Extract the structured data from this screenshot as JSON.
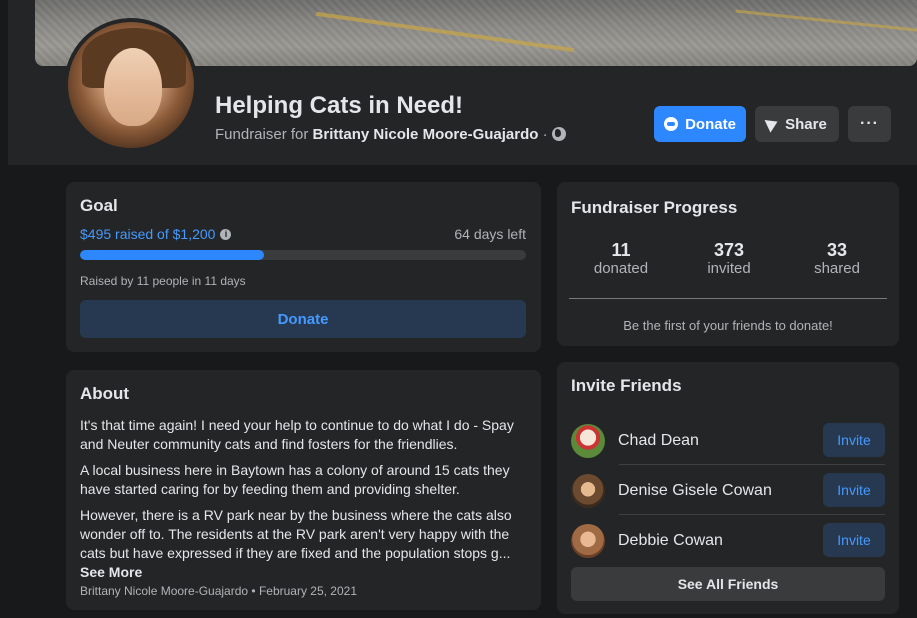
{
  "header": {
    "title": "Helping Cats in Need!",
    "subtitle_prefix": "Fundraiser for",
    "organizer": "Brittany Nicole Moore-Guajardo",
    "separator": "·",
    "globe_icon": "globe-icon"
  },
  "actions": {
    "donate_label": "Donate",
    "share_label": "Share",
    "more_label": "···"
  },
  "goal": {
    "heading": "Goal",
    "raised_text": "$495 raised of $1,200",
    "info_icon": "i",
    "days_left": "64 days left",
    "progress_fraction": 0.4125,
    "raised_by": "Raised by 11 people in 11 days",
    "donate_label": "Donate"
  },
  "about": {
    "heading": "About",
    "paragraphs": [
      "It's that time again! I need your help to continue to do what I do - Spay and Neuter community cats and find fosters for the friendlies.",
      "A local business here in Baytown has a colony of around 15 cats they have started caring for by feeding them and providing shelter.",
      "However, there is a RV park near by the business where the cats also wonder off to. The residents at the RV park aren't very happy with the cats but have expressed if they are fixed and the population stops g..."
    ],
    "see_more": "See More",
    "meta": "Brittany Nicole Moore-Guajardo • February 25, 2021"
  },
  "progress": {
    "heading": "Fundraiser Progress",
    "stats": [
      {
        "value": "11",
        "label": "donated"
      },
      {
        "value": "373",
        "label": "invited"
      },
      {
        "value": "33",
        "label": "shared"
      }
    ],
    "note": "Be the first of your friends to donate!"
  },
  "invite": {
    "heading": "Invite Friends",
    "friends": [
      {
        "name": "Chad Dean",
        "button": "Invite"
      },
      {
        "name": "Denise Gisele Cowan",
        "button": "Invite"
      },
      {
        "name": "Debbie Cowan",
        "button": "Invite"
      }
    ],
    "see_all": "See All Friends"
  },
  "colors": {
    "accent": "#2d88ff",
    "card": "#242526",
    "background": "#18191a"
  }
}
